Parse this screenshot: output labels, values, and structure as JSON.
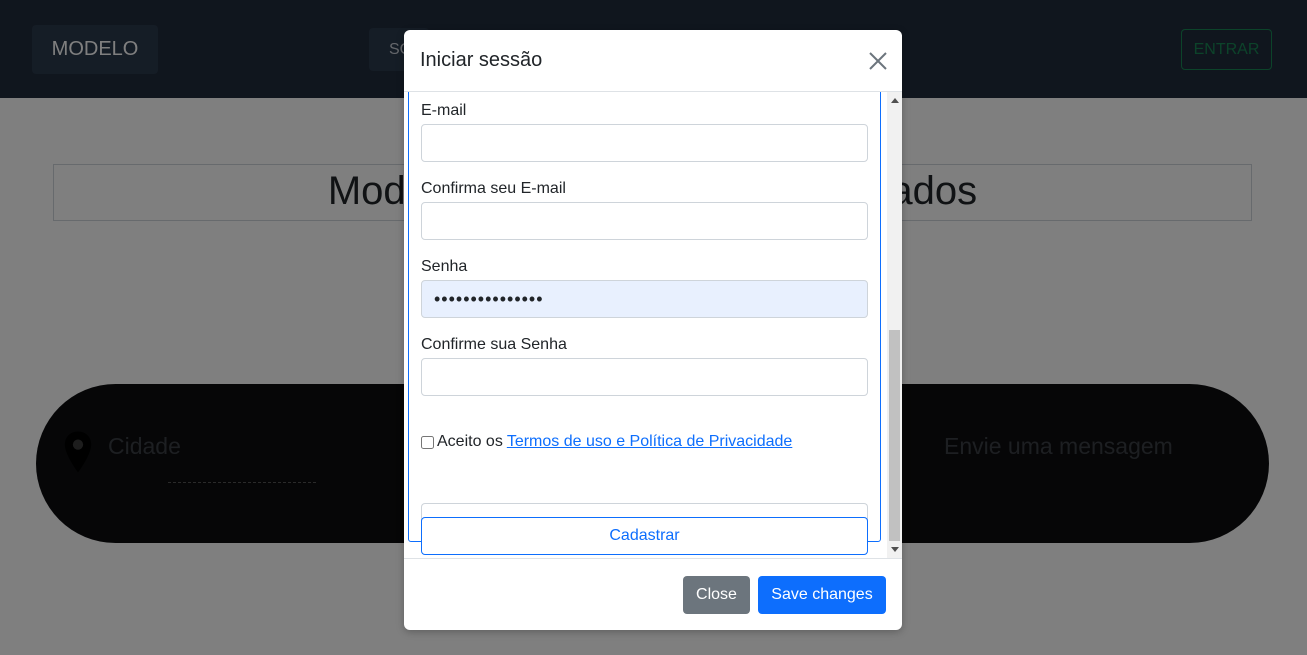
{
  "page": {
    "brand": "MODELO",
    "nav_item": "SOBRE",
    "login_button": "ENTRAR",
    "hero_title": "Modelo de site para visualizar dados",
    "contact": {
      "city_label": "Cidade",
      "message_label": "Envie uma mensagem"
    }
  },
  "modal": {
    "title": "Iniciar sessão",
    "fields": {
      "email_label": "E-mail",
      "email_value": "",
      "confirm_email_label": "Confirma seu E-mail",
      "confirm_email_value": "",
      "password_label": "Senha",
      "password_value": "•••••••••••••••",
      "confirm_password_label": "Confirme sua Senha",
      "confirm_password_value": ""
    },
    "terms": {
      "prefix": "Aceito os",
      "link": "Termos de uso e Política de Privacidade",
      "checked": false
    },
    "submit_label": "Cadastrar",
    "footer": {
      "close_label": "Close",
      "save_label": "Save changes"
    }
  },
  "colors": {
    "navbar": "#212d3d",
    "primary": "#0d6efd",
    "secondary": "#6c757d",
    "success": "#198754",
    "autofill": "#e8f0fe"
  }
}
